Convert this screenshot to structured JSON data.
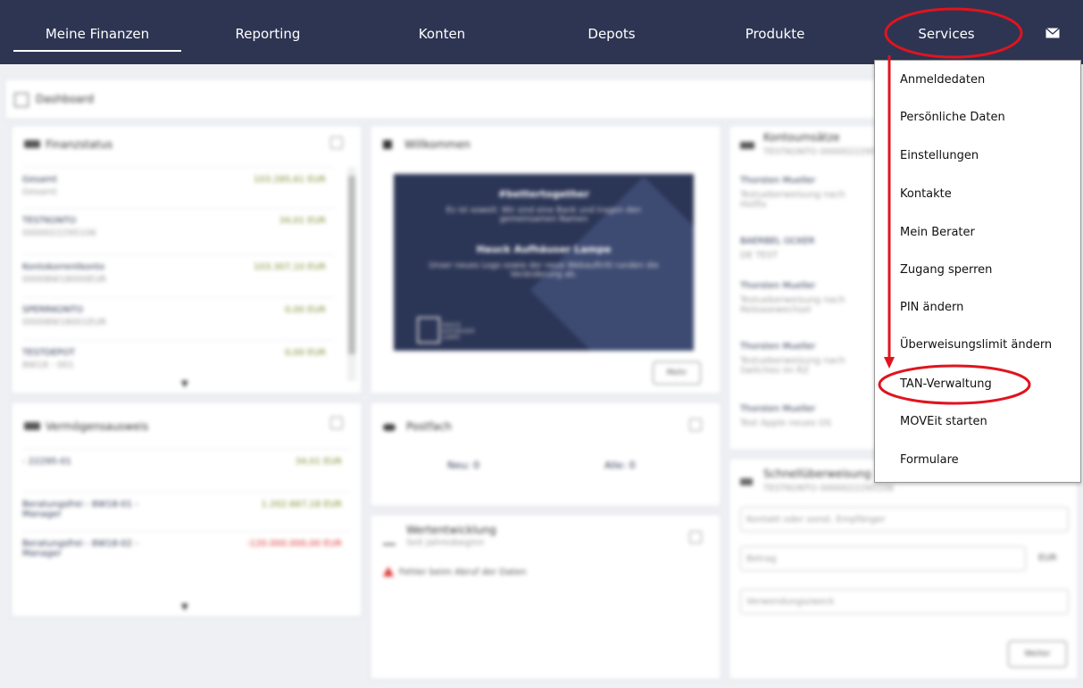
{
  "nav": {
    "items": [
      "Meine Finanzen",
      "Reporting",
      "Konten",
      "Depots",
      "Produkte",
      "Services"
    ],
    "mail_icon": "envelope-icon"
  },
  "dashboard": {
    "title": "Dashboard"
  },
  "finanzstatus": {
    "title": "Finanzstatus",
    "rows": [
      {
        "name": "Gesamt",
        "sub": "Gesamt",
        "value": "103.285,61 EUR"
      },
      {
        "name": "TESTKONTO",
        "sub": "0000022295106",
        "value": "34,01 EUR"
      },
      {
        "name": "Kontokorrentkonto",
        "sub": "00008W18000EUR",
        "value": "103.307,10 EUR"
      },
      {
        "name": "SPERRKONTO",
        "sub": "00008W18001EUR",
        "value": "0,00 EUR"
      },
      {
        "name": "TESTDEPOT",
        "sub": "8W18 - 001",
        "value": "0,00 EUR"
      }
    ]
  },
  "willkommen": {
    "title": "Willkommen",
    "banner_heading": "#bettertogether",
    "banner_line1": "Es ist soweit: Wir sind eine Bank und tragen den gemeinsamen Namen",
    "banner_brand": "Hauck Aufhäuser Lampe",
    "banner_line2": "Unser neues Logo sowie der neue Webauftritt runden die Veränderung ab.",
    "logo_text": "HAUCK AUFHÄUSER LAMPE",
    "more_label": "Mehr"
  },
  "kontoumsaetze": {
    "title": "Kontoumsätze",
    "subtitle": "TESTKONTO 000002229510",
    "rows": [
      {
        "name": "Thorsten Mueller",
        "sub": "Testueberweisung nach Hotfix"
      },
      {
        "name": "BAERBEL OCKER",
        "sub": "DE TEST"
      },
      {
        "name": "Thorsten Mueller",
        "sub": "Testueberweisung nach Releasewechsel"
      },
      {
        "name": "Thorsten Mueller",
        "sub": "Testueberweisung nach Switches im RZ"
      },
      {
        "name": "Thorsten Mueller",
        "sub": "Test Apple neues OS"
      }
    ]
  },
  "vermoegen": {
    "title": "Vermögensausweis",
    "rows": [
      {
        "name": "- 22295-01",
        "value": "34,01 EUR",
        "neg": false
      },
      {
        "name": "Beratungsfrei - 8W18-01 - Manager",
        "value": "1.202.667,18 EUR",
        "neg": false
      },
      {
        "name": "Beratungsfrei - 8W18-02 - Manager",
        "value": "-120.000.000,00 EUR",
        "neg": true
      }
    ]
  },
  "postfach": {
    "title": "Postfach",
    "neu": "Neu: 0",
    "alle": "Alle: 0"
  },
  "wertentwicklung": {
    "title": "Wertentwicklung",
    "subtitle": "Seit Jahresbeginn",
    "error": "Fehler beim Abruf der Daten"
  },
  "schnell": {
    "title": "Schnellüberweisung",
    "subtitle": "TESTKONTO 0000022295106",
    "recipient_placeholder": "Kontakt oder sonst. Empfänger",
    "amount_placeholder": "Betrag",
    "currency": "EUR",
    "purpose_placeholder": "Verwendungszweck",
    "next_label": "Weiter"
  },
  "menu": {
    "items": [
      "Anmeldedaten",
      "Persönliche Daten",
      "Einstellungen",
      "Kontakte",
      "Mein Berater",
      "Zugang sperren",
      "PIN ändern",
      "Überweisungslimit ändern",
      "TAN-Verwaltung",
      "MOVEit starten",
      "Formulare"
    ],
    "highlight_color": "#e0141e"
  }
}
